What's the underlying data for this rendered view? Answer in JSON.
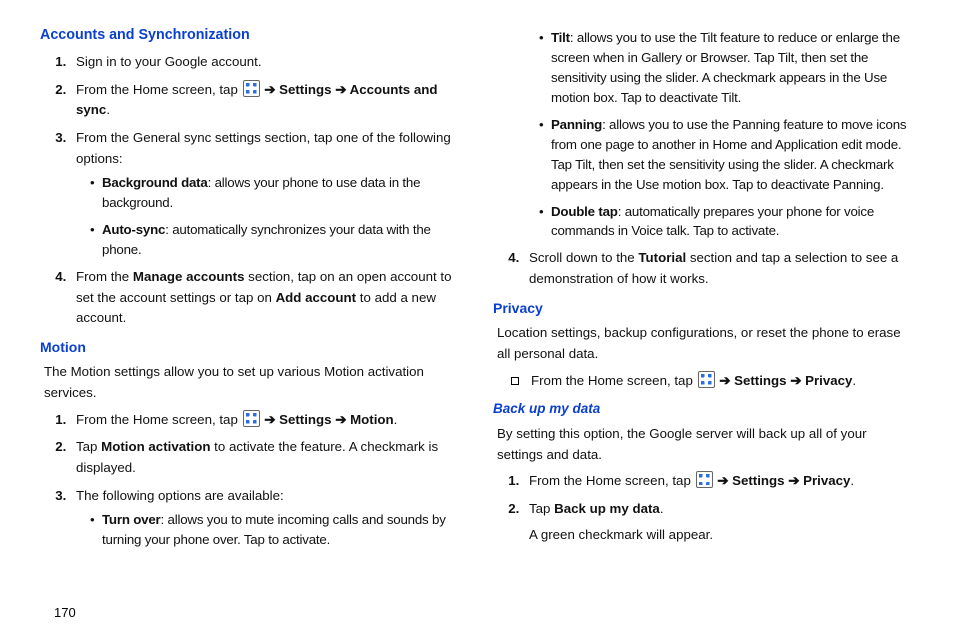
{
  "pageNumber": "170",
  "arrow": "➔",
  "left": {
    "h1": "Accounts and Synchronization",
    "ol1": {
      "i1": "Sign in to your Google account.",
      "i2a": "From the Home screen, tap ",
      "i2b": " Settings ",
      "i2c": " Accounts and sync",
      "i2d": ".",
      "i3": "From the General sync settings section, tap one of the following options:",
      "i3_b1_t": "Background data",
      "i3_b1_r": ": allows your phone to use data in the background.",
      "i3_b2_t": "Auto-sync",
      "i3_b2_r": ": automatically synchronizes your data with the phone.",
      "i4a": "From the ",
      "i4b": "Manage accounts",
      "i4c": " section, tap on an open account to set the account settings or tap on ",
      "i4d": "Add account",
      "i4e": " to add a new account."
    },
    "h2": "Motion",
    "p1": "The Motion settings allow you to set up various Motion activation services.",
    "ol2": {
      "i1a": "From the Home screen, tap ",
      "i1b": " Settings ",
      "i1c": " Motion",
      "i1d": ".",
      "i2a": "Tap ",
      "i2b": "Motion activation",
      "i2c": " to activate the feature. A checkmark is displayed.",
      "i3": "The following options are available:",
      "i3_b1_t": "Turn over",
      "i3_b1_r": ": allows you to mute incoming calls and sounds by turning your phone over. Tap to activate."
    }
  },
  "right": {
    "topbul": {
      "b1_t": "Tilt",
      "b1_r": ": allows you to use the Tilt feature to reduce or enlarge the screen when in Gallery or Browser. Tap Tilt, then set the sensitivity using the slider. A checkmark appears in the Use motion box. Tap to deactivate Tilt.",
      "b2_t": "Panning",
      "b2_r": ": allows you to use the Panning feature to move icons from one page to another in Home and Application edit mode. Tap Tilt, then set the sensitivity using the slider. A checkmark appears in the Use motion box. Tap to deactivate Panning.",
      "b3_t": "Double tap",
      "b3_r": ": automatically prepares your phone for voice commands in Voice talk. Tap to activate."
    },
    "ol4": {
      "i4a": "Scroll down to the ",
      "i4b": "Tutorial",
      "i4c": " section and tap a selection to see a demonstration of how it works."
    },
    "h1": "Privacy",
    "p1": "Location settings, backup configurations, or reset the phone to erase all personal data.",
    "sq_a": "From the Home screen, tap ",
    "sq_b": " Settings ",
    "sq_c": " Privacy",
    "sq_d": ".",
    "h2": "Back up my data",
    "p2": "By setting this option, the Google server will back up all of your settings and data.",
    "ol2": {
      "i1a": "From the Home screen, tap ",
      "i1b": " Settings ",
      "i1c": " Privacy",
      "i1d": ".",
      "i2a": "Tap ",
      "i2b": "Back up my data",
      "i2c": ".",
      "i3": "A green checkmark will appear."
    }
  }
}
